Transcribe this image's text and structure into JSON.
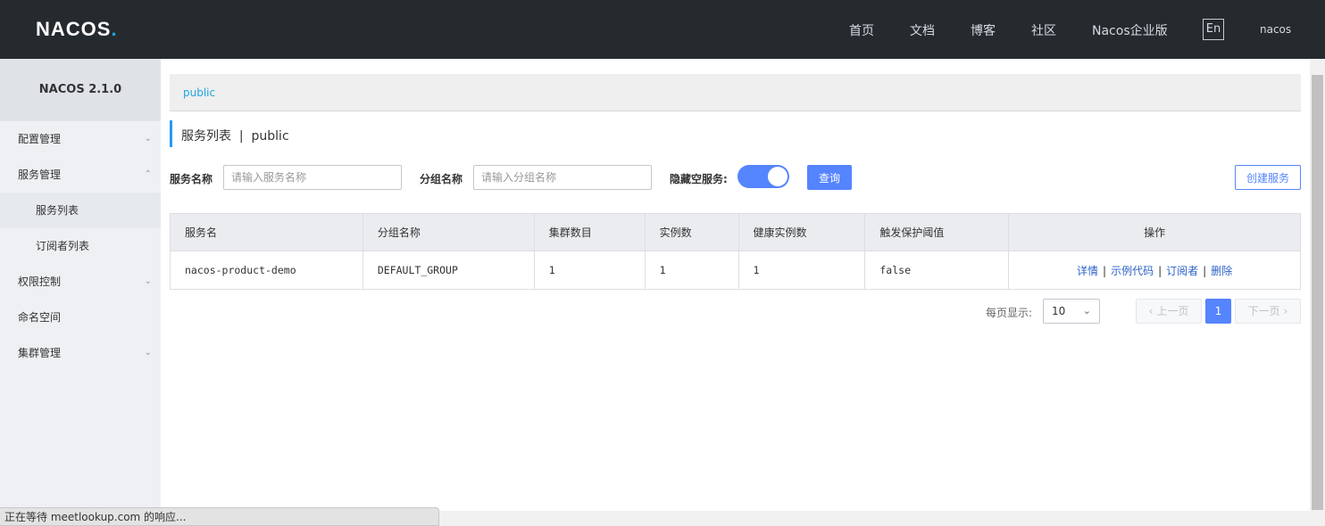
{
  "header": {
    "logo": "NACOS",
    "logo_dot": ".",
    "nav": [
      "首页",
      "文档",
      "博客",
      "社区",
      "Nacos企业版"
    ],
    "lang": "En",
    "user": "nacos"
  },
  "sidebar": {
    "title": "NACOS 2.1.0",
    "items": [
      {
        "label": "配置管理"
      },
      {
        "label": "服务管理"
      },
      {
        "label": "服务列表"
      },
      {
        "label": "订阅者列表"
      },
      {
        "label": "权限控制"
      },
      {
        "label": "命名空间"
      },
      {
        "label": "集群管理"
      }
    ]
  },
  "breadcrumb": "public",
  "page_title": "服务列表  |  public",
  "filters": {
    "service_name_label": "服务名称",
    "service_name_placeholder": "请输入服务名称",
    "group_name_label": "分组名称",
    "group_name_placeholder": "请输入分组名称",
    "hide_empty_label": "隐藏空服务:",
    "hide_empty_on": true,
    "query_label": "查询",
    "create_label": "创建服务"
  },
  "table": {
    "columns": [
      "服务名",
      "分组名称",
      "集群数目",
      "实例数",
      "健康实例数",
      "触发保护阈值",
      "操作"
    ],
    "rows": [
      {
        "name": "nacos-product-demo",
        "group": "DEFAULT_GROUP",
        "clusters": "1",
        "instances": "1",
        "healthy": "1",
        "threshold": "false",
        "ops": [
          "详情",
          "示例代码",
          "订阅者",
          "删除"
        ]
      }
    ]
  },
  "pagination": {
    "per_page_label": "每页显示:",
    "per_page": "10",
    "prev": "上一页",
    "current": "1",
    "next": "下一页"
  },
  "status_bar": "正在等待 meetlookup.com 的响应..."
}
